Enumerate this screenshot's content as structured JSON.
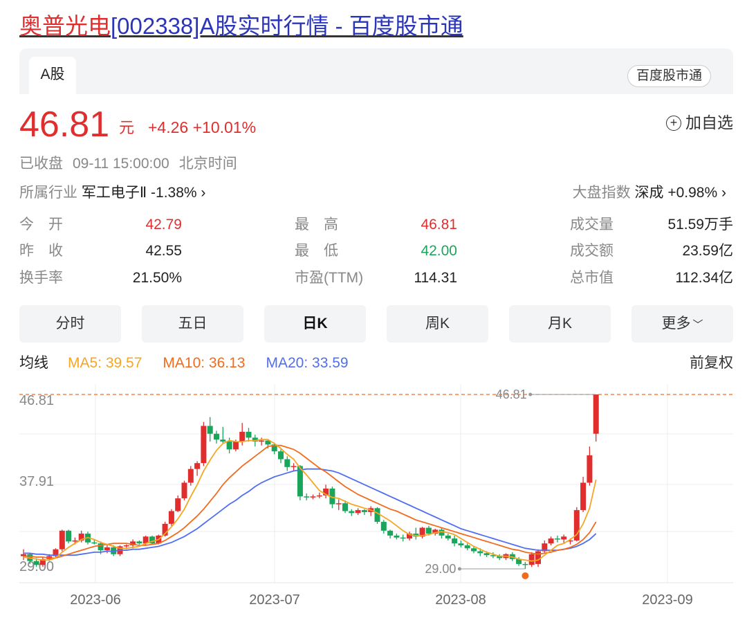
{
  "title": {
    "name": "奥普光电",
    "rest": "[002338]A股实时行情 - 百度股市通"
  },
  "tab": {
    "label": "A股"
  },
  "badge": "百度股市通",
  "quote": {
    "price": "46.81",
    "unit": "元",
    "change": "+4.26",
    "change_pct": "+10.01%",
    "add_label": "加自选",
    "status": "已收盘",
    "time": "09-11 15:00:00",
    "timezone": "北京时间"
  },
  "industry": {
    "label": "所属行业",
    "name": "军工电子Ⅱ",
    "change": "-1.38%"
  },
  "index": {
    "label": "大盘指数",
    "name": "深成",
    "change": "+0.98%"
  },
  "stats": {
    "open_label": "今　开",
    "open": "42.79",
    "prev_label": "昨　收",
    "prev": "42.55",
    "turnover_label": "换手率",
    "turnover": "21.50%",
    "high_label": "最　高",
    "high": "46.81",
    "low_label": "最　低",
    "low": "42.00",
    "pe_label": "市盈(TTM)",
    "pe": "114.31",
    "volume_label": "成交量",
    "volume": "51.59万手",
    "amount_label": "成交额",
    "amount": "23.59亿",
    "mcap_label": "总市值",
    "mcap": "112.34亿"
  },
  "periods": [
    "分时",
    "五日",
    "日K",
    "周K",
    "月K",
    "更多"
  ],
  "active_period": "日K",
  "ma": {
    "label": "均线",
    "ma5": "MA5: 39.57",
    "ma10": "MA10: 36.13",
    "ma20": "MA20: 33.59"
  },
  "adjust": "前复权",
  "colors": {
    "up": "#e02e2e",
    "down": "#19a65b",
    "ma5": "#f5a623",
    "ma10": "#f26b1d",
    "ma20": "#4f6ef2",
    "link": "#2b35b8"
  },
  "chart_data": {
    "type": "candlestick",
    "y_ticks": [
      "46.81",
      "37.91",
      "29.00"
    ],
    "ylim": [
      29.0,
      46.81
    ],
    "x_ticks": [
      "2023-06",
      "2023-07",
      "2023-08",
      "2023-09"
    ],
    "max_label": "46.81",
    "min_label": "29.00",
    "candles": [
      [
        30.3,
        31.0,
        29.9,
        30.5
      ],
      [
        30.5,
        30.6,
        29.5,
        29.8
      ],
      [
        29.8,
        30.1,
        29.2,
        29.4
      ],
      [
        29.4,
        30.2,
        29.2,
        30.0
      ],
      [
        30.0,
        30.5,
        29.8,
        30.3
      ],
      [
        30.3,
        31.1,
        30.1,
        31.0
      ],
      [
        31.0,
        33.0,
        30.8,
        32.9
      ],
      [
        32.9,
        33.0,
        31.6,
        31.8
      ],
      [
        31.8,
        32.2,
        31.5,
        31.9
      ],
      [
        31.9,
        32.9,
        31.7,
        32.6
      ],
      [
        32.6,
        32.8,
        31.5,
        31.7
      ],
      [
        31.7,
        32.0,
        31.5,
        31.6
      ],
      [
        31.6,
        31.8,
        30.5,
        30.9
      ],
      [
        30.9,
        31.5,
        30.6,
        31.2
      ],
      [
        31.2,
        31.4,
        30.3,
        30.5
      ],
      [
        30.5,
        31.4,
        30.3,
        31.3
      ],
      [
        31.3,
        31.5,
        31.0,
        31.4
      ],
      [
        31.4,
        32.0,
        31.1,
        31.8
      ],
      [
        31.8,
        31.9,
        31.5,
        31.6
      ],
      [
        31.6,
        32.4,
        31.4,
        32.3
      ],
      [
        32.3,
        32.4,
        31.5,
        31.6
      ],
      [
        31.6,
        32.5,
        31.5,
        32.4
      ],
      [
        32.4,
        33.8,
        32.3,
        33.6
      ],
      [
        33.6,
        35.1,
        33.4,
        34.9
      ],
      [
        34.9,
        36.5,
        34.8,
        36.2
      ],
      [
        36.2,
        38.0,
        36.0,
        37.8
      ],
      [
        37.8,
        39.5,
        37.5,
        39.2
      ],
      [
        39.2,
        40.0,
        38.5,
        39.8
      ],
      [
        39.8,
        44.0,
        39.5,
        43.6
      ],
      [
        43.6,
        44.5,
        42.0,
        42.8
      ],
      [
        42.8,
        43.1,
        41.8,
        42.2
      ],
      [
        42.2,
        43.5,
        41.8,
        42.0
      ],
      [
        42.0,
        42.4,
        40.8,
        41.2
      ],
      [
        41.2,
        42.2,
        41.0,
        42.0
      ],
      [
        42.0,
        43.9,
        41.6,
        43.0
      ],
      [
        43.0,
        43.4,
        42.0,
        42.4
      ],
      [
        42.4,
        42.7,
        41.5,
        42.0
      ],
      [
        42.0,
        42.4,
        41.6,
        42.1
      ],
      [
        42.1,
        42.2,
        41.3,
        41.7
      ],
      [
        41.7,
        41.9,
        40.7,
        41.0
      ],
      [
        41.0,
        41.2,
        39.8,
        40.2
      ],
      [
        40.2,
        40.5,
        39.0,
        39.4
      ],
      [
        39.4,
        39.8,
        39.0,
        39.5
      ],
      [
        39.5,
        39.6,
        36.0,
        36.4
      ],
      [
        36.4,
        36.7,
        36.0,
        36.3
      ],
      [
        36.3,
        36.6,
        36.1,
        36.4
      ],
      [
        36.4,
        36.8,
        36.2,
        36.5
      ],
      [
        36.5,
        37.6,
        36.2,
        37.2
      ],
      [
        37.2,
        37.4,
        35.2,
        35.6
      ],
      [
        35.6,
        36.1,
        35.0,
        35.7
      ],
      [
        35.7,
        36.0,
        34.7,
        34.9
      ],
      [
        34.9,
        35.1,
        34.4,
        34.7
      ],
      [
        34.7,
        35.2,
        34.5,
        35.0
      ],
      [
        35.0,
        35.1,
        34.5,
        34.8
      ],
      [
        34.8,
        35.4,
        34.4,
        35.2
      ],
      [
        35.2,
        35.3,
        33.6,
        33.8
      ],
      [
        33.8,
        34.0,
        32.6,
        32.9
      ],
      [
        32.9,
        33.0,
        32.1,
        32.4
      ],
      [
        32.4,
        32.6,
        32.0,
        32.2
      ],
      [
        32.2,
        32.5,
        31.8,
        32.1
      ],
      [
        32.1,
        32.8,
        31.9,
        32.6
      ],
      [
        32.6,
        33.2,
        32.0,
        32.3
      ],
      [
        32.3,
        33.3,
        32.1,
        33.2
      ],
      [
        33.2,
        33.4,
        32.4,
        32.6
      ],
      [
        32.6,
        33.1,
        32.4,
        33.0
      ],
      [
        33.0,
        33.2,
        32.1,
        32.4
      ],
      [
        32.4,
        32.6,
        31.9,
        32.1
      ],
      [
        32.1,
        32.4,
        31.3,
        31.6
      ],
      [
        31.6,
        31.9,
        31.2,
        31.4
      ],
      [
        31.4,
        31.6,
        30.9,
        31.1
      ],
      [
        31.1,
        31.3,
        30.6,
        30.8
      ],
      [
        30.8,
        31.1,
        30.3,
        30.6
      ],
      [
        30.6,
        30.8,
        30.2,
        30.4
      ],
      [
        30.4,
        30.7,
        30.1,
        30.3
      ],
      [
        30.3,
        30.5,
        29.9,
        30.1
      ],
      [
        30.1,
        30.6,
        29.9,
        30.5
      ],
      [
        30.5,
        30.7,
        29.8,
        30.0
      ],
      [
        30.0,
        30.2,
        29.3,
        29.5
      ],
      [
        29.5,
        29.7,
        29.0,
        29.4
      ],
      [
        29.4,
        30.7,
        29.2,
        30.5
      ],
      [
        29.5,
        31.0,
        29.2,
        30.8
      ],
      [
        30.8,
        31.9,
        30.6,
        31.6
      ],
      [
        31.6,
        32.3,
        31.4,
        32.1
      ],
      [
        32.1,
        32.4,
        31.7,
        32.0
      ],
      [
        32.0,
        32.5,
        31.6,
        32.3
      ],
      [
        31.8,
        32.1,
        31.5,
        31.9
      ],
      [
        31.9,
        35.3,
        31.8,
        35.0
      ],
      [
        35.0,
        38.4,
        34.8,
        37.8
      ],
      [
        37.8,
        41.5,
        37.5,
        40.6
      ],
      [
        42.8,
        46.81,
        42.0,
        46.81
      ]
    ],
    "ma5": [
      30.2,
      30.1,
      30.0,
      29.9,
      29.9,
      30.1,
      30.7,
      31.2,
      31.6,
      32.0,
      32.2,
      32.0,
      31.7,
      31.5,
      31.3,
      31.1,
      31.1,
      31.2,
      31.3,
      31.6,
      31.8,
      32.0,
      32.6,
      33.3,
      34.1,
      35.1,
      36.4,
      37.6,
      39.0,
      40.1,
      41.1,
      41.8,
      42.1,
      42.0,
      42.0,
      42.1,
      42.1,
      42.2,
      42.2,
      41.8,
      41.3,
      40.7,
      40.2,
      39.3,
      38.6,
      37.8,
      37.0,
      36.6,
      36.3,
      36.2,
      35.9,
      35.6,
      35.4,
      35.2,
      35.0,
      34.7,
      34.3,
      33.9,
      33.4,
      32.9,
      32.5,
      32.4,
      32.4,
      32.5,
      32.7,
      32.8,
      32.7,
      32.5,
      32.1,
      31.7,
      31.3,
      31.0,
      30.7,
      30.5,
      30.3,
      30.3,
      30.2,
      30.0,
      29.9,
      29.8,
      29.9,
      30.4,
      30.9,
      31.4,
      31.6,
      32.0,
      32.5,
      33.6,
      35.2,
      38.1
    ],
    "ma10": [
      30.3,
      30.3,
      30.2,
      30.2,
      30.1,
      30.1,
      30.3,
      30.5,
      30.7,
      30.9,
      31.1,
      31.3,
      31.4,
      31.5,
      31.6,
      31.6,
      31.6,
      31.5,
      31.4,
      31.4,
      31.5,
      31.6,
      31.9,
      32.3,
      32.7,
      33.2,
      33.8,
      34.4,
      35.1,
      35.9,
      36.7,
      37.6,
      38.3,
      38.9,
      39.5,
      40.0,
      40.5,
      41.0,
      41.5,
      41.6,
      41.6,
      41.4,
      41.2,
      40.8,
      40.3,
      39.8,
      39.3,
      38.9,
      38.4,
      37.9,
      37.4,
      37.0,
      36.6,
      36.3,
      36.0,
      35.7,
      35.4,
      35.1,
      34.9,
      34.6,
      34.3,
      34.0,
      33.8,
      33.6,
      33.4,
      33.2,
      33.0,
      32.8,
      32.6,
      32.4,
      32.2,
      32.0,
      31.8,
      31.6,
      31.4,
      31.2,
      31.0,
      30.9,
      30.7,
      30.6,
      30.5,
      30.6,
      30.7,
      30.9,
      31.0,
      31.2,
      31.5,
      32.0,
      32.7,
      33.8
    ],
    "ma20": [
      30.6,
      30.6,
      30.5,
      30.5,
      30.4,
      30.4,
      30.4,
      30.4,
      30.4,
      30.5,
      30.6,
      30.7,
      30.7,
      30.8,
      30.8,
      30.9,
      30.9,
      31.0,
      31.0,
      31.1,
      31.2,
      31.3,
      31.5,
      31.7,
      32.0,
      32.3,
      32.7,
      33.1,
      33.6,
      34.1,
      34.6,
      35.1,
      35.6,
      36.0,
      36.5,
      36.9,
      37.4,
      37.8,
      38.1,
      38.4,
      38.6,
      38.8,
      39.0,
      39.1,
      39.2,
      39.2,
      39.2,
      39.1,
      39.0,
      38.8,
      38.5,
      38.2,
      37.9,
      37.6,
      37.3,
      37.0,
      36.7,
      36.4,
      36.1,
      35.8,
      35.5,
      35.2,
      34.9,
      34.6,
      34.3,
      34.0,
      33.7,
      33.4,
      33.1,
      32.9,
      32.7,
      32.5,
      32.3,
      32.1,
      31.9,
      31.7,
      31.5,
      31.3,
      31.1,
      31.0,
      30.9,
      30.9,
      30.9,
      30.9,
      31.0,
      31.1,
      31.3,
      31.6,
      32.0,
      32.6
    ]
  }
}
